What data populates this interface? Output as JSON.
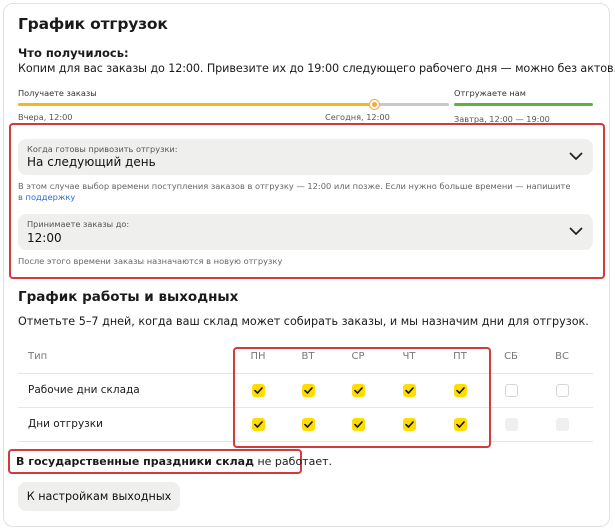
{
  "title": "График отгрузок",
  "result": {
    "label": "Что получилось:",
    "text": "Копим для вас заказы до 12:00. Привезите их до 19:00 следующего рабочего дня — можно без актов."
  },
  "timeline": {
    "receive_label": "Получаете заказы",
    "ship_label": "Отгружаете нам",
    "from_time": "Вчера, 12:00",
    "to_time": "Сегодня, 12:00",
    "ship_time": "Завтра, 12:00 — 19:00",
    "colors": {
      "receive": "#f5b81c",
      "gap": "#c9c9c9",
      "ship": "#5cb33c",
      "dot": "#ffa53b"
    }
  },
  "shipment_select": {
    "label": "Когда готовы привозить отгрузки:",
    "value": "На следующий день",
    "hint": "В этом случае выбор времени поступления заказов в отгрузку — 12:00 или позже. Если нужно больше времени — напишите",
    "hint_prefix": "в",
    "hint_link": "поддержку"
  },
  "cutoff_select": {
    "label": "Принимаете заказы до:",
    "value": "12:00",
    "hint": "После этого времени заказы назначаются в новую отгрузку"
  },
  "schedule": {
    "title": "График работы и выходных",
    "subtitle": "Отметьте 5–7 дней, когда ваш склад может собирать заказы, и мы назначим дни для отгрузок.",
    "type_header": "Тип",
    "days": [
      "ПН",
      "ВТ",
      "СР",
      "ЧТ",
      "ПТ",
      "СБ",
      "ВС"
    ],
    "rows": [
      {
        "label": "Рабочие дни склада",
        "checked": [
          true,
          true,
          true,
          true,
          true,
          false,
          false
        ],
        "disabled": [
          false,
          false,
          false,
          false,
          false,
          false,
          false
        ]
      },
      {
        "label": "Дни отгрузки",
        "checked": [
          true,
          true,
          true,
          true,
          true,
          false,
          false
        ],
        "disabled": [
          false,
          false,
          false,
          false,
          false,
          true,
          true
        ]
      }
    ]
  },
  "holiday": {
    "bold": "В государственные праздники склад",
    "rest": " не работает."
  },
  "weekend_button": "К настройкам выходных",
  "colors": {
    "accent_yellow": "#ffdd00",
    "highlight_red": "#d33a3a",
    "link": "#2f6ad6"
  }
}
